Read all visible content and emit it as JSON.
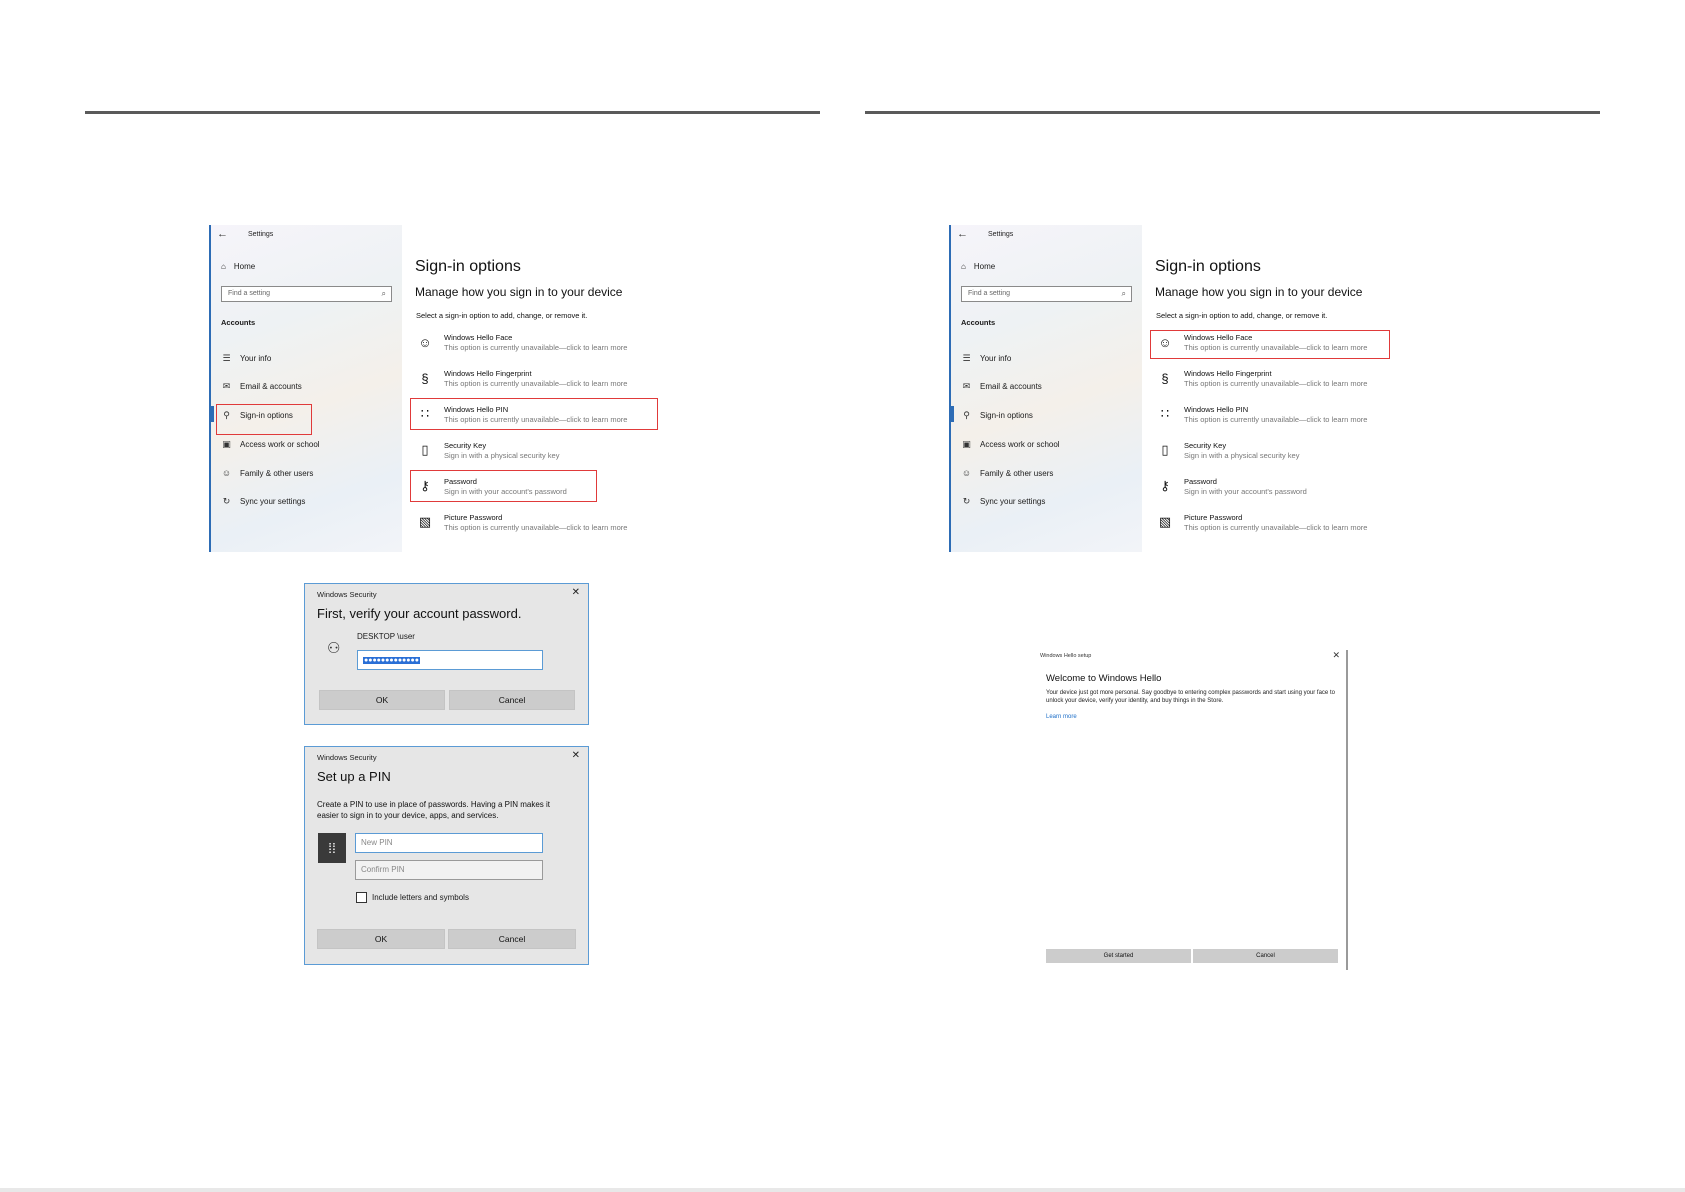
{
  "settings": {
    "title": "Settings",
    "back_icon": "←",
    "home_label": "Home",
    "search_placeholder": "Find a setting",
    "accounts_heading": "Accounts",
    "nav": [
      {
        "label": "Your info",
        "icon": "☰"
      },
      {
        "label": "Email & accounts",
        "icon": "✉"
      },
      {
        "label": "Sign-in options",
        "icon": "⚲"
      },
      {
        "label": "Access work or school",
        "icon": "▣"
      },
      {
        "label": "Family & other users",
        "icon": "☺"
      },
      {
        "label": "Sync your settings",
        "icon": "↻"
      }
    ],
    "main_title": "Sign-in options",
    "main_subtitle": "Manage how you sign in to your device",
    "main_desc": "Select a sign-in option to add, change, or remove it.",
    "options": [
      {
        "title": "Windows Hello Face",
        "sub": "This option is currently unavailable—click to learn more",
        "icon": "☺"
      },
      {
        "title": "Windows Hello Fingerprint",
        "sub": "This option is currently unavailable—click to learn more",
        "icon": "§"
      },
      {
        "title": "Windows Hello PIN",
        "sub": "This option is currently unavailable—click to learn more",
        "icon": "∷"
      },
      {
        "title": "Security Key",
        "sub": "Sign in with a physical security key",
        "icon": "▯"
      },
      {
        "title": "Password",
        "sub": "Sign in with your account's password",
        "icon": "⚷"
      },
      {
        "title": "Picture Password",
        "sub": "This option is currently unavailable—click to learn more",
        "icon": "▧"
      }
    ]
  },
  "verify_dialog": {
    "title": "Windows Security",
    "heading": "First, verify your account password.",
    "username": "DESKTOP \\user",
    "password_value": "●●●●●●●●●●●●●",
    "ok_label": "OK",
    "cancel_label": "Cancel"
  },
  "pin_dialog": {
    "title": "Windows Security",
    "heading": "Set up a PIN",
    "desc_line1": "Create a PIN to use in place of passwords. Having a PIN makes it",
    "desc_line2": "easier to sign in to your device, apps, and services.",
    "new_pin_placeholder": "New PIN",
    "confirm_pin_placeholder": "Confirm PIN",
    "checkbox_label": "Include letters and symbols",
    "ok_label": "OK",
    "cancel_label": "Cancel"
  },
  "hello_dialog": {
    "title": "Windows Hello setup",
    "heading": "Welcome to Windows Hello",
    "body": "Your device just got more personal. Say goodbye to entering complex passwords and start using your face to unlock your device, verify your identity, and buy things in the Store.",
    "link": "Learn more",
    "get_started_label": "Get started",
    "cancel_label": "Cancel"
  },
  "colors": {
    "accent": "#2d6cb5",
    "highlight": "#e03a3a",
    "dialog_border": "#5b9bd5"
  }
}
